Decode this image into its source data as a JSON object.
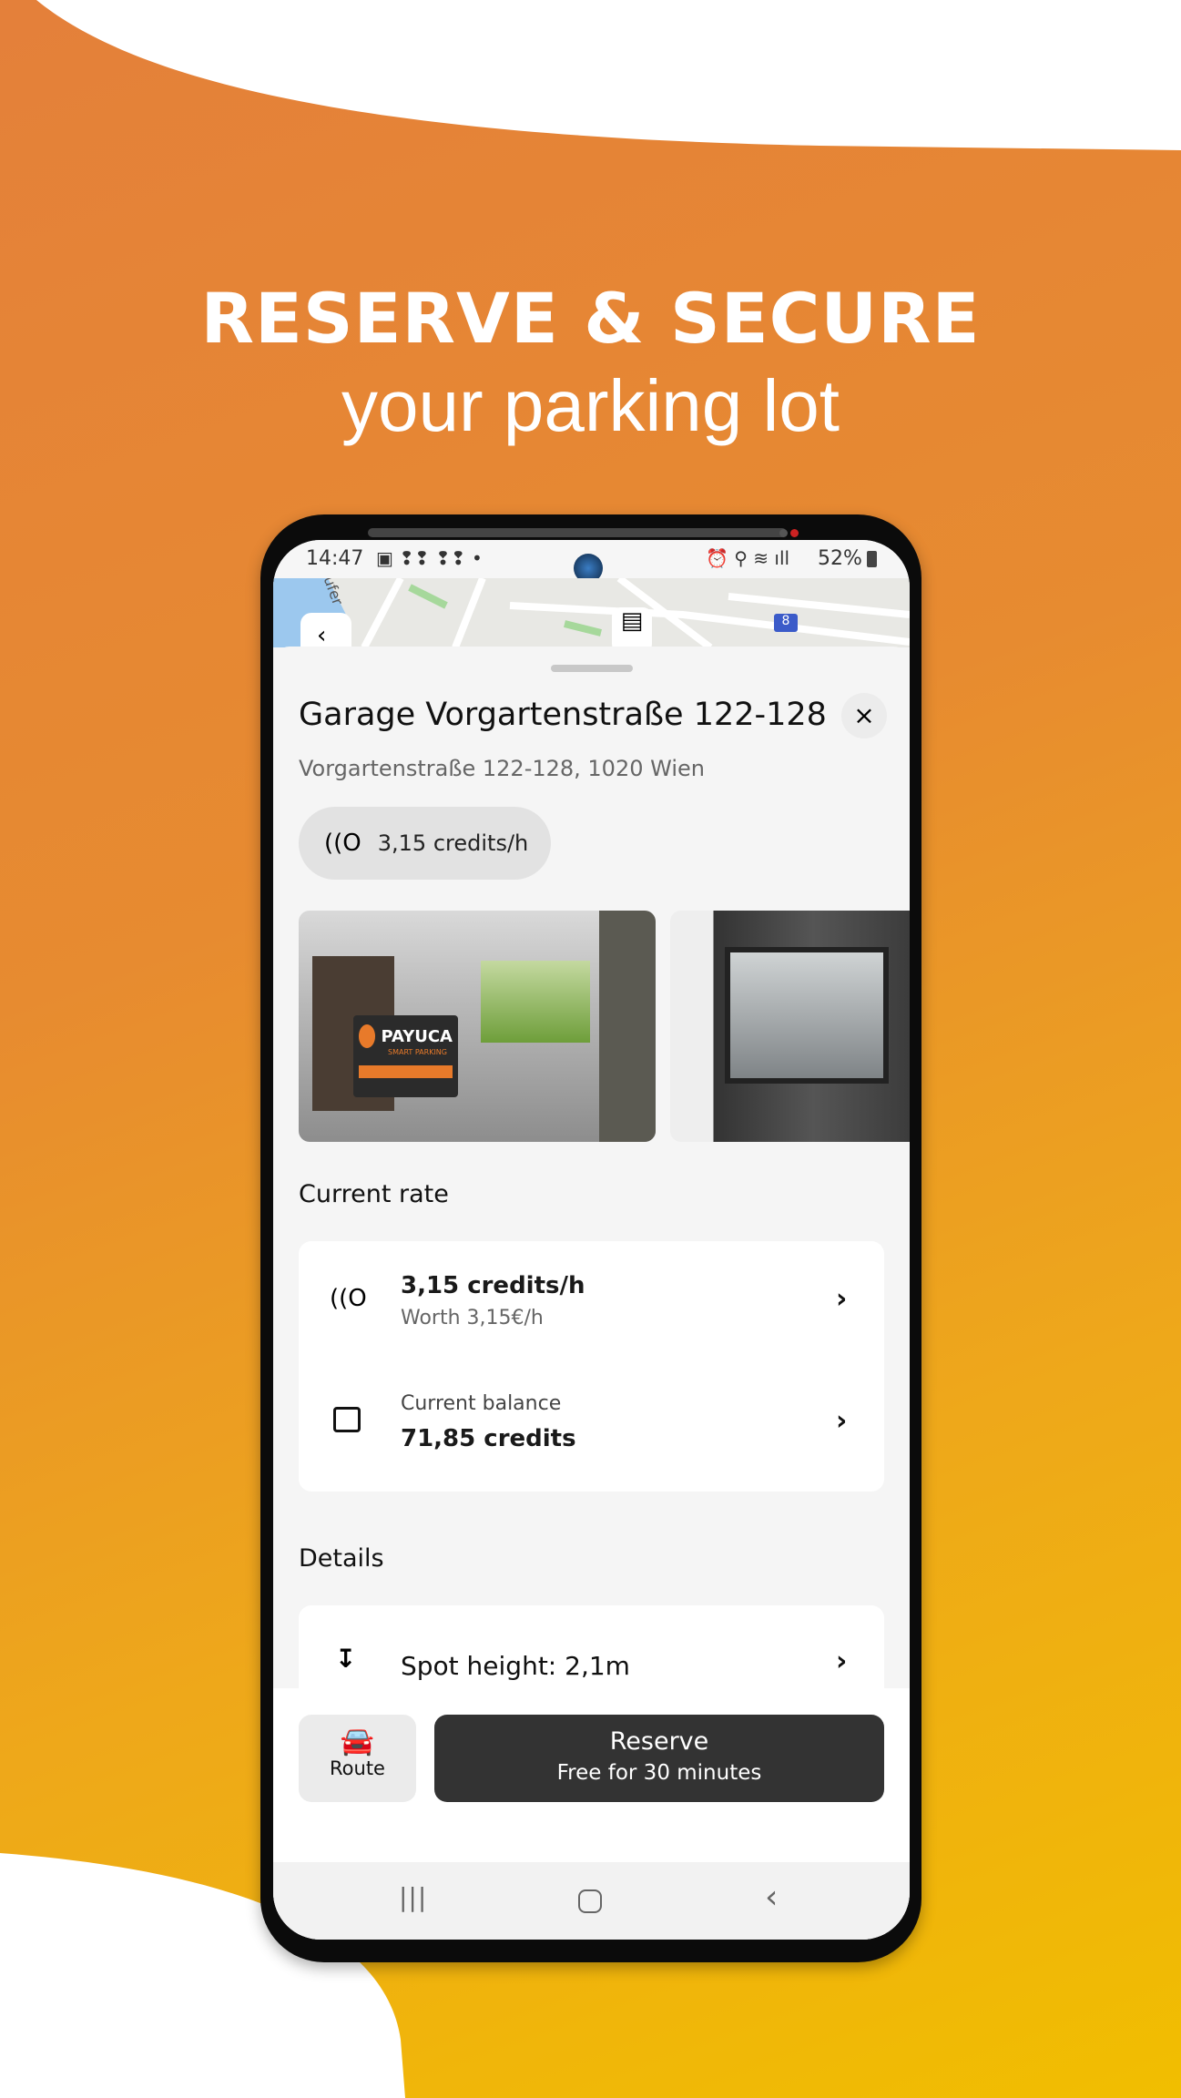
{
  "promo": {
    "headline": "RESERVE & SECURE",
    "subheadline": "your parking lot"
  },
  "colors": {
    "gradient_start": "#E4803A",
    "gradient_end": "#F1BE00",
    "primary_button": "#333333"
  },
  "status_bar": {
    "time": "14:47",
    "battery": "52%"
  },
  "map": {
    "route_badge": "8",
    "street_label": "ufer"
  },
  "parking": {
    "title": "Garage Vorgartenstraße 122-128",
    "address": "Vorgartenstraße 122-128, 1020 Wien",
    "rate_chip": "3,15 credits/h",
    "photo_sign": "PAYUCA",
    "photo_sign_sub": "SMART PARKING"
  },
  "current_rate": {
    "heading": "Current rate",
    "rate": {
      "title": "3,15 credits/h",
      "subtitle": "Worth 3,15€/h"
    },
    "balance": {
      "label": "Current balance",
      "value": "71,85 credits"
    }
  },
  "details": {
    "heading": "Details",
    "spot_height": "Spot height: 2,1m"
  },
  "actions": {
    "route_label": "Route",
    "reserve_label": "Reserve",
    "reserve_sub": "Free for 30 minutes"
  }
}
